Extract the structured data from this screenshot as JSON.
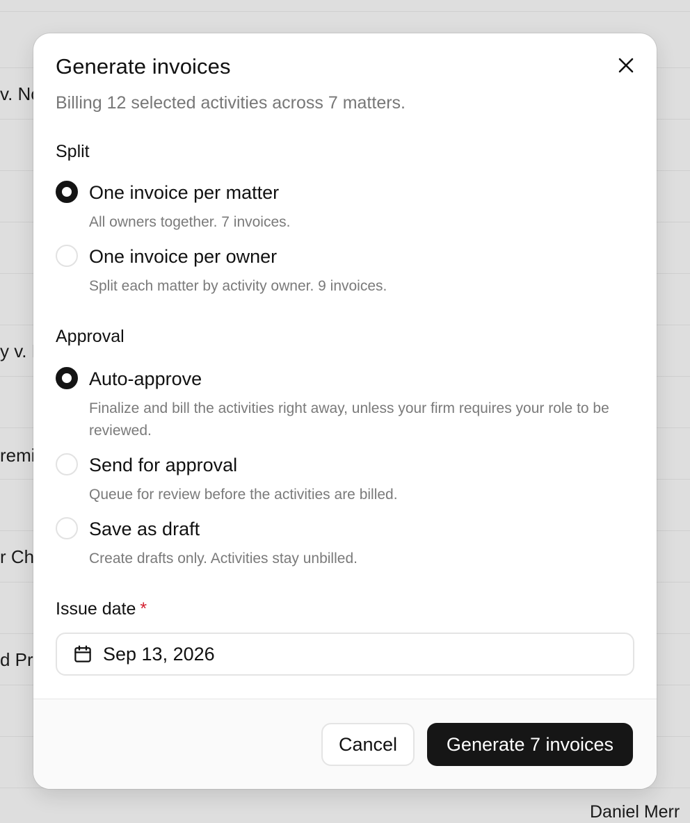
{
  "background": {
    "row_fragments": [
      "v. No",
      "y v. K",
      "remis",
      "r Chi",
      "d Pr"
    ],
    "footer_name": "Daniel Merr"
  },
  "modal": {
    "title": "Generate invoices",
    "subtitle": "Billing 12 selected activities across 7 matters.",
    "split": {
      "label": "Split",
      "options": [
        {
          "label": "One invoice per matter",
          "description": "All owners together. 7 invoices.",
          "selected": true
        },
        {
          "label": "One invoice per owner",
          "description": "Split each matter by activity owner. 9 invoices.",
          "selected": false
        }
      ]
    },
    "approval": {
      "label": "Approval",
      "options": [
        {
          "label": "Auto-approve",
          "description": "Finalize and bill the activities right away, unless your firm requires your role to be reviewed.",
          "selected": true
        },
        {
          "label": "Send for approval",
          "description": "Queue for review before the activities are billed.",
          "selected": false
        },
        {
          "label": "Save as draft",
          "description": "Create drafts only. Activities stay unbilled.",
          "selected": false
        }
      ]
    },
    "issue_date": {
      "label": "Issue date",
      "required_mark": "*",
      "value": "Sep 13, 2026"
    },
    "footer": {
      "cancel_label": "Cancel",
      "primary_label": "Generate 7 invoices"
    }
  },
  "colors": {
    "primary": "#161616",
    "required": "#d32030"
  }
}
